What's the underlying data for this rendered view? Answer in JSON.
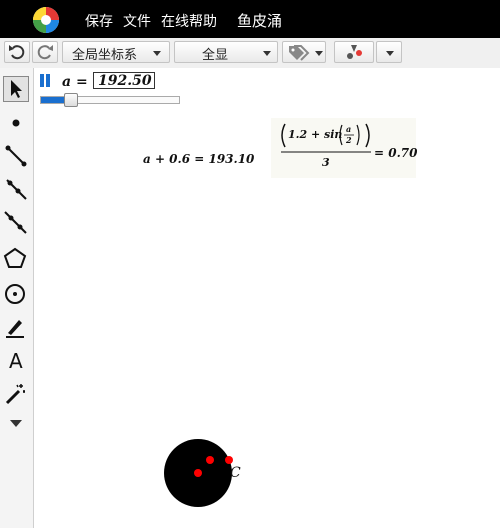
{
  "menu": {
    "save": "保存",
    "file": "文件",
    "online_help": "在线帮助",
    "app_name": "鱼皮涌"
  },
  "toolbar": {
    "coord_system": "全局坐标系",
    "show_all": "全显",
    "undo_icon": "undo-icon",
    "redo_icon": "redo-icon",
    "tag_icon": "tag-icon",
    "style_icon": "color-style-icon"
  },
  "tools": [
    {
      "name": "arrow-tool-icon"
    },
    {
      "name": "point-tool-icon"
    },
    {
      "name": "segment-tool-icon"
    },
    {
      "name": "ray-tool-icon"
    },
    {
      "name": "line-tool-icon"
    },
    {
      "name": "polygon-tool-icon"
    },
    {
      "name": "circle-tool-icon"
    },
    {
      "name": "freehand-tool-icon"
    },
    {
      "name": "text-tool-icon"
    },
    {
      "name": "magic-wand-tool-icon"
    },
    {
      "name": "more-tools-icon"
    }
  ],
  "slider": {
    "var_label": "a =",
    "value": "192.50",
    "fill_fraction": 0.2
  },
  "expressions": {
    "sum": "a + 0.6 = 193.10",
    "fraction_num_const": "1.2 + sin",
    "fraction_num_var": "a",
    "fraction_num_den": "2",
    "fraction_den": "3",
    "fraction_result": "= 0.70"
  },
  "figure": {
    "point_label": "C",
    "disk_color": "#000000",
    "point_color": "#ff0000"
  },
  "text_tool_glyph": "A"
}
